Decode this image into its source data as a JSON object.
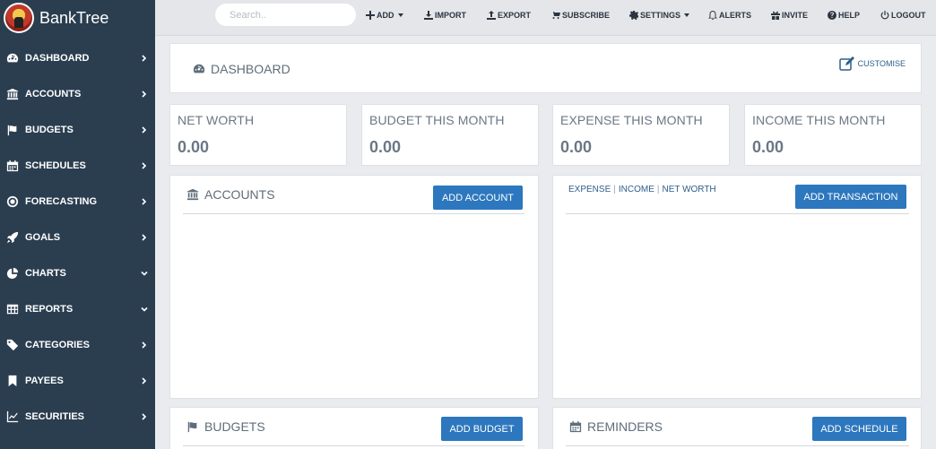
{
  "brand": {
    "name": "BankTree"
  },
  "sidebar": {
    "items": [
      {
        "label": "DASHBOARD",
        "icon": "dashboard-icon",
        "chevron": "right"
      },
      {
        "label": "ACCOUNTS",
        "icon": "bank-icon",
        "chevron": "right"
      },
      {
        "label": "BUDGETS",
        "icon": "flag-icon",
        "chevron": "right"
      },
      {
        "label": "SCHEDULES",
        "icon": "calendar-icon",
        "chevron": "right"
      },
      {
        "label": "FORECASTING",
        "icon": "target-icon",
        "chevron": "right"
      },
      {
        "label": "GOALS",
        "icon": "rocket-icon",
        "chevron": "right"
      },
      {
        "label": "CHARTS",
        "icon": "pie-chart-icon",
        "chevron": "down"
      },
      {
        "label": "REPORTS",
        "icon": "table-icon",
        "chevron": "down"
      },
      {
        "label": "CATEGORIES",
        "icon": "tag-icon",
        "chevron": "right"
      },
      {
        "label": "PAYEES",
        "icon": "bookmark-icon",
        "chevron": "right"
      },
      {
        "label": "SECURITIES",
        "icon": "line-chart-icon",
        "chevron": "right"
      }
    ]
  },
  "topbar": {
    "search_placeholder": "Search..",
    "add": "ADD",
    "import": "IMPORT",
    "export": "EXPORT",
    "subscribe": "SUBSCRIBE",
    "settings": "SETTINGS",
    "alerts": "ALERTS",
    "invite": "INVITE",
    "help": "HELP",
    "logout": "LOGOUT"
  },
  "dashboard": {
    "title": "DASHBOARD",
    "customise": "CUSTOMISE",
    "stats": [
      {
        "label": "NET WORTH",
        "value": "0.00"
      },
      {
        "label": "BUDGET THIS MONTH",
        "value": "0.00"
      },
      {
        "label": "EXPENSE THIS MONTH",
        "value": "0.00"
      },
      {
        "label": "INCOME THIS MONTH",
        "value": "0.00"
      }
    ],
    "accounts": {
      "title": "ACCOUNTS",
      "button": "ADD ACCOUNT"
    },
    "transactions": {
      "tabs": [
        "EXPENSE",
        "INCOME",
        "NET WORTH"
      ],
      "separator": "|",
      "button": "ADD TRANSACTION"
    },
    "budgets": {
      "title": "BUDGETS",
      "button": "ADD BUDGET"
    },
    "reminders": {
      "title": "REMINDERS",
      "button": "ADD SCHEDULE"
    }
  },
  "colors": {
    "sidebar": "#2b3e50",
    "accent": "#2d77be",
    "background": "#e9ebee"
  }
}
